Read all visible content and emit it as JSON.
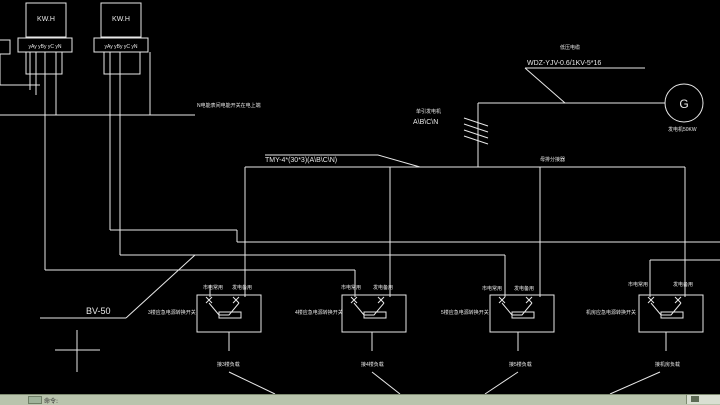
{
  "meters": [
    {
      "label": "KW.H",
      "terminals": "yAy yBy yC yN"
    },
    {
      "label": "KW.H",
      "terminals": "yAy yBy yC yN"
    }
  ],
  "generator": {
    "symbol": "G",
    "rating": "发电机50KW",
    "cable_title": "低压电缆",
    "cable_spec": "WDZ-YJV-0.6/1KV-5*16"
  },
  "neutral_note": "N电能表间电能开关在电上端",
  "busbar_entry": {
    "title": "单引发电机",
    "phases": "A\\B\\C\\N"
  },
  "busbar": {
    "spec": "TMY-4*(30*3)(A\\B\\C\\N)",
    "note": "母排分接器"
  },
  "feeder_cable": "BV-50",
  "ats_units": [
    {
      "main_label": "市电常用",
      "backup_label": "发电备用",
      "name": "3楼应急电源转换开关",
      "load": "接3楼负载"
    },
    {
      "main_label": "市电常用",
      "backup_label": "发电备用",
      "name": "4楼应急电源转换开关",
      "load": "接4楼负载"
    },
    {
      "main_label": "市电常用",
      "backup_label": "发电备用",
      "name": "5楼应急电源转换开关",
      "load": "接5楼负载"
    },
    {
      "main_label": "市电常用",
      "backup_label": "发电备用",
      "name": "机房应急电源转换开关",
      "load": "接机房负载"
    }
  ],
  "statusbar": {
    "command_text": "命令:"
  }
}
